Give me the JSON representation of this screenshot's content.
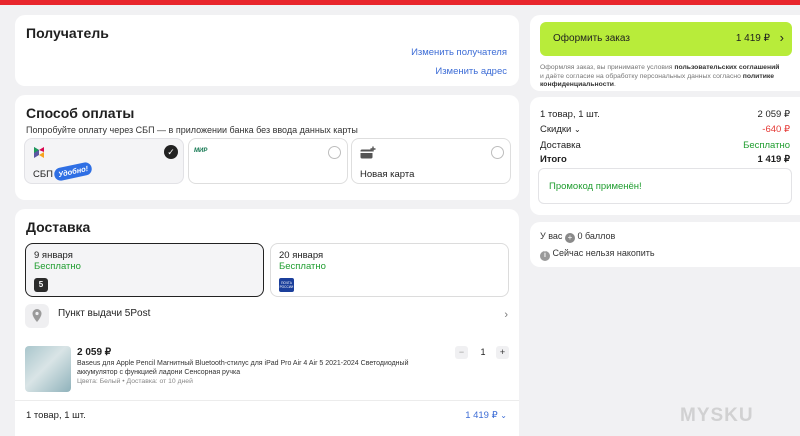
{
  "recipient": {
    "title": "Получатель",
    "change_recipient": "Изменить получателя",
    "change_address": "Изменить адрес"
  },
  "payment": {
    "title": "Способ оплаты",
    "hint": "Попробуйте оплату через СБП — в приложении банка без ввода данных карты",
    "options": [
      {
        "label": "СБП",
        "badge": "Удобно!",
        "selected": true
      },
      {
        "label": "",
        "logo_text": "МИР",
        "selected": false
      },
      {
        "label": "Новая карта",
        "selected": false
      }
    ]
  },
  "delivery": {
    "title": "Доставка",
    "dates": [
      {
        "date": "9 января",
        "price": "Бесплатно",
        "carrier": "5"
      },
      {
        "date": "20 января",
        "price": "Бесплатно",
        "carrier": "ПОЧТА РОССИИ"
      }
    ],
    "pickup_label": "Пункт выдачи 5Post",
    "item": {
      "price": "2 059 ₽",
      "name": "Baseus для Apple Pencil Магнитный Bluetooth-стилус для iPad Pro Air 4 Air 5 2021-2024 Светодиодный аккумулятор с функцией ладони Сенсорная ручка",
      "meta": "Цвета: Белый • Доставка: от 10 дней",
      "qty": "1",
      "minus": "−",
      "plus": "+"
    },
    "footer_count": "1 товар, 1 шт.",
    "footer_total": "1 419 ₽"
  },
  "order": {
    "button_label": "Оформить заказ",
    "button_total": "1 419 ₽",
    "terms_1": "Оформляя заказ, вы принимаете условия ",
    "terms_link1": "пользовательских соглашений",
    "terms_2": " и даёте согласие на обработку персональных данных согласно ",
    "terms_link2": "политике конфиденциальности",
    "terms_3": "."
  },
  "summary": {
    "rows": [
      {
        "label": "1 товар, 1 шт.",
        "value": "2 059 ₽"
      },
      {
        "label": "Скидки",
        "value": "-640 ₽"
      },
      {
        "label": "Доставка",
        "value": "Бесплатно"
      },
      {
        "label": "Итого",
        "value": "1 419 ₽"
      }
    ],
    "promo": "Промокод применён!"
  },
  "points": {
    "balance_prefix": "У вас",
    "balance_value": "0 баллов",
    "note": "Сейчас нельзя накопить"
  },
  "watermark": "MYSKU",
  "colors": {
    "accent_green": "#b8ec3a",
    "link": "#3d6dd6",
    "free_green": "#1f9d2f",
    "discount_red": "#e53935",
    "top_bar": "#e8262c"
  }
}
